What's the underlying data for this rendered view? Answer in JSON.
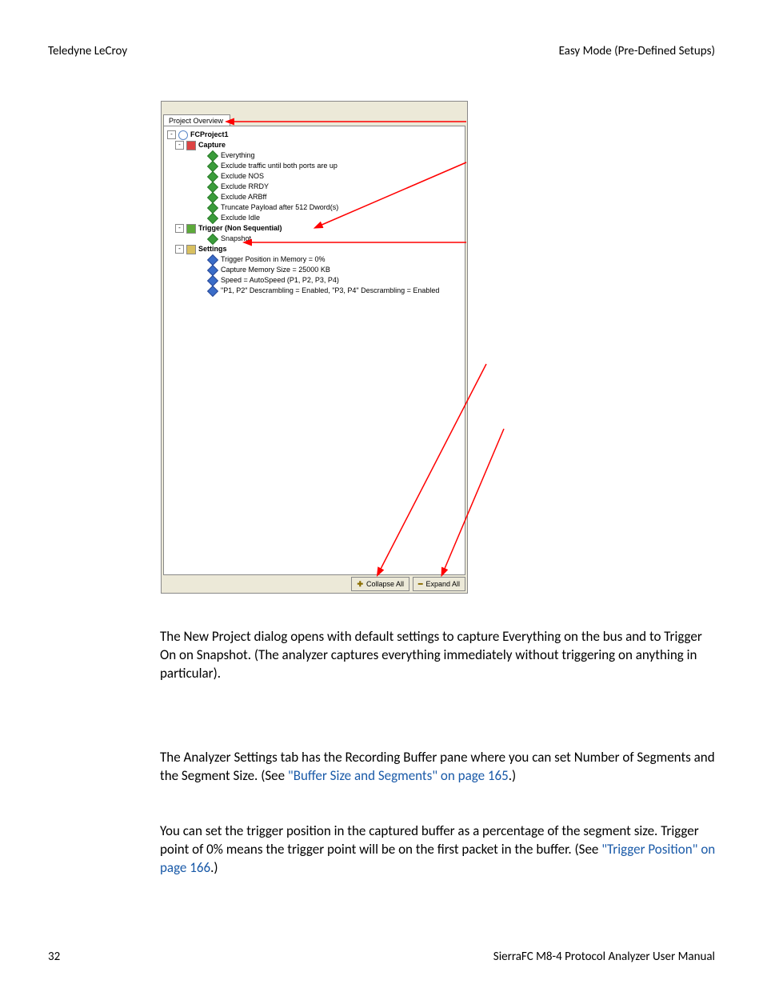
{
  "header": {
    "left": "Teledyne LeCroy",
    "right": "Easy Mode (Pre-Defined Setups)"
  },
  "panel": {
    "tab_label": "Project Overview",
    "tree": {
      "root": "FCProject1",
      "capture": {
        "label": "Capture",
        "items": [
          "Everything",
          "Exclude traffic until both ports are up",
          "Exclude NOS",
          "Exclude RRDY",
          "Exclude ARBff",
          "Truncate Payload after 512 Dword(s)",
          "Exclude Idle"
        ]
      },
      "trigger": {
        "label": "Trigger (Non Sequential)",
        "items": [
          "Snapshot"
        ]
      },
      "settings": {
        "label": "Settings",
        "items": [
          "Trigger Position in Memory = 0%",
          "Capture Memory Size = 25000 KB",
          "Speed = AutoSpeed (P1, P2, P3, P4)",
          "\"P1, P2\" Descrambling = Enabled, \"P3, P4\" Descrambling = Enabled"
        ]
      }
    },
    "buttons": {
      "collapse": "Collapse All",
      "expand": "Expand All"
    }
  },
  "paragraphs": {
    "p1": "The New Project dialog opens with default settings to capture Everything on the bus and to Trigger On on Snapshot. (The analyzer captures everything immediately without triggering on anything in particular).",
    "p2a": "The Analyzer Settings tab has the Recording Buffer pane where you can set Number of Segments and the Segment Size. (See ",
    "p2link": "\"Buffer Size and Segments\" on page 165",
    "p2b": ".)",
    "p3a": "You can set the trigger position in the captured buffer as a percentage of the segment size. Trigger point of 0% means the trigger point will be on the first packet in the buffer. (See ",
    "p3link": "\"Trigger Position\" on page 166",
    "p3b": ".)"
  },
  "footer": {
    "page": "32",
    "manual": "SierraFC M8-4 Protocol Analyzer User Manual"
  }
}
